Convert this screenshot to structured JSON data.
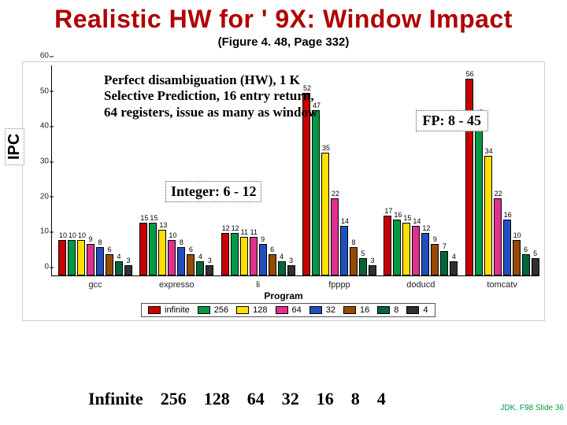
{
  "title": "Realistic HW for ' 9X: Window Impact",
  "subtitle": "(Figure 4. 48, Page 332)",
  "ylabel": "IPC",
  "xlabel": "Program",
  "perfect_text": "Perfect disambiguation (HW), 1 K Selective Prediction, 16 entry return, 64 registers, issue as many as window",
  "fp_text": "FP: 8 - 45",
  "integer_text": "Integer: 6 - 12",
  "bottom_labels": [
    "Infinite",
    "256",
    "128",
    "64",
    "32",
    "16",
    "8",
    "4"
  ],
  "footer": "JDK. F98\nSlide  36",
  "chart_data": {
    "type": "bar",
    "categories": [
      "gcc",
      "expresso",
      "li",
      "fpppp",
      "doducd",
      "tomcatv"
    ],
    "series": [
      {
        "name": "infinite",
        "color": "#c80000",
        "values": [
          10,
          15,
          12,
          52,
          17,
          56
        ]
      },
      {
        "name": "256",
        "color": "#009944",
        "values": [
          10,
          15,
          12,
          47,
          16,
          45
        ]
      },
      {
        "name": "128",
        "color": "#ffe000",
        "values": [
          10,
          13,
          11,
          35,
          15,
          34
        ]
      },
      {
        "name": "64",
        "color": "#e03090",
        "values": [
          9,
          10,
          11,
          22,
          14,
          22
        ]
      },
      {
        "name": "32",
        "color": "#2050c0",
        "values": [
          8,
          8,
          9,
          14,
          12,
          16
        ]
      },
      {
        "name": "16",
        "color": "#964B00",
        "values": [
          6,
          6,
          6,
          8,
          9,
          10
        ]
      },
      {
        "name": "8",
        "color": "#006838",
        "values": [
          4,
          4,
          4,
          5,
          7,
          6
        ]
      },
      {
        "name": "4",
        "color": "#303030",
        "values": [
          3,
          3,
          3,
          3,
          4,
          5
        ]
      }
    ],
    "ylim": [
      0,
      60
    ],
    "yticks": [
      0,
      10,
      20,
      30,
      40,
      50,
      60
    ],
    "legend_labels": [
      "infinite",
      "256",
      "128",
      "64",
      "32",
      "16",
      "8",
      "4"
    ]
  }
}
